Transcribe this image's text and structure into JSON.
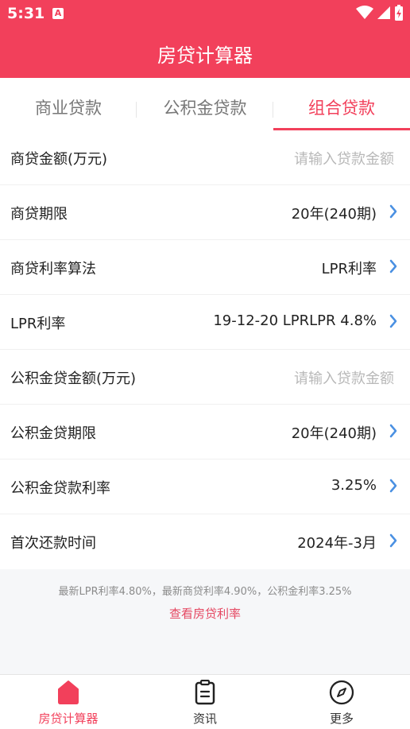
{
  "status_bar": {
    "time": "5:31",
    "app_icon": "A"
  },
  "header": {
    "title": "房贷计算器"
  },
  "tabs": [
    {
      "label": "商业贷款"
    },
    {
      "label": "公积金贷款"
    },
    {
      "label": "组合贷款"
    }
  ],
  "form": {
    "rows": [
      {
        "label": "商贷金额(万元)",
        "placeholder": "请输入贷款金额"
      },
      {
        "label": "商贷期限",
        "value": "20年(240期)"
      },
      {
        "label": "商贷利率算法",
        "value": "LPR利率"
      },
      {
        "label": "LPR利率",
        "value": "19-12-20 LPRLPR 4.8%"
      },
      {
        "label": "公积金贷金额(万元)",
        "placeholder": "请输入贷款金额"
      },
      {
        "label": "公积金贷期限",
        "value": "20年(240期)"
      },
      {
        "label": "公积金贷款利率",
        "value": "3.25%"
      },
      {
        "label": "首次还款时间",
        "value": "2024年-3月"
      }
    ]
  },
  "info": {
    "note": "最新LPR利率4.80%，最新商贷利率4.90%，公积金利率3.25%",
    "link": "查看房贷利率"
  },
  "bottom_nav": [
    {
      "label": "房贷计算器",
      "icon": "home-icon"
    },
    {
      "label": "资讯",
      "icon": "clipboard-icon"
    },
    {
      "label": "更多",
      "icon": "compass-icon"
    }
  ],
  "colors": {
    "accent": "#f2405b",
    "link": "#e54862",
    "chevron": "#4a90e2"
  }
}
